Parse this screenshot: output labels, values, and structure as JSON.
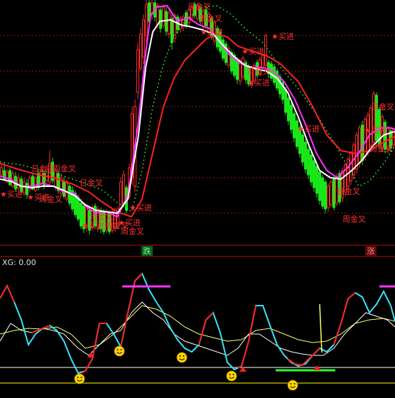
{
  "indicator": {
    "name": "XG",
    "value": "0.00",
    "text": "XG: 0.00"
  },
  "badges": {
    "down": "跌",
    "up": "涨"
  },
  "signal_labels": {
    "daily_golden_cross": "日金叉",
    "weekly_golden_cross": "周金叉",
    "monthly_golden_cross": "月金叉",
    "buy": "买进",
    "buy_arrow": "买进"
  },
  "colors": {
    "background": "#000000",
    "up_candle": "#ff2a2a",
    "down_candle": "#19e619",
    "ma_white": "#ffffff",
    "ma_magenta": "#ff33ff",
    "ma_red": "#ff2020",
    "ma_green_dotted": "#33ff33",
    "osc_red": "#ff2020",
    "osc_cyan": "#33e6ff",
    "osc_yellow": "#ffff66",
    "osc_white": "#ffffff",
    "signal_magenta": "#ff33ff",
    "signal_green": "#33ff33",
    "grid_red": "#8a1a1a",
    "smiley": "#ffd700"
  }
}
